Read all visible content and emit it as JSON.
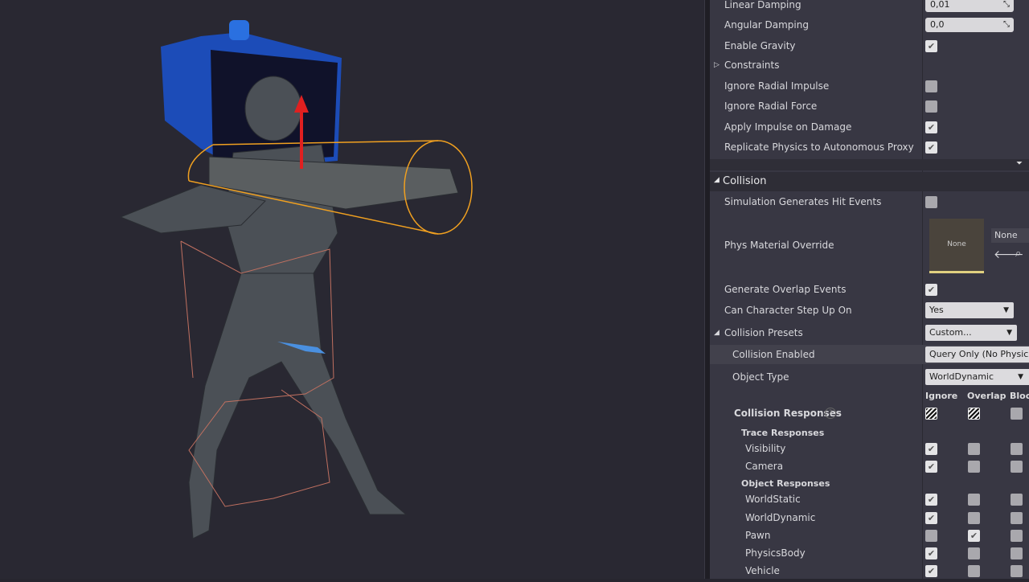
{
  "physics": {
    "linear_damping": {
      "label": "Linear Damping",
      "value": "0,01"
    },
    "angular_damping": {
      "label": "Angular Damping",
      "value": "0,0"
    },
    "enable_gravity": {
      "label": "Enable Gravity",
      "checked": true
    },
    "constraints": {
      "label": "Constraints"
    },
    "ignore_radial_impulse": {
      "label": "Ignore Radial Impulse",
      "checked": false
    },
    "ignore_radial_force": {
      "label": "Ignore Radial Force",
      "checked": false
    },
    "apply_impulse": {
      "label": "Apply Impulse on Damage",
      "checked": true
    },
    "replicate": {
      "label": "Replicate Physics to Autonomous Proxy",
      "checked": true
    }
  },
  "collision": {
    "title": "Collision",
    "sim_hit_events": {
      "label": "Simulation Generates Hit Events",
      "checked": false
    },
    "phys_material": {
      "label": "Phys Material Override",
      "thumb": "None",
      "value": "None"
    },
    "overlap_events": {
      "label": "Generate Overlap Events",
      "checked": true
    },
    "step_up": {
      "label": "Can Character Step Up On",
      "value": "Yes"
    },
    "presets": {
      "label": "Collision Presets",
      "value": "Custom..."
    },
    "enabled": {
      "label": "Collision Enabled",
      "value": "Query Only (No Physics Collision)"
    },
    "object_type": {
      "label": "Object Type",
      "value": "WorldDynamic"
    },
    "columns": [
      "Ignore",
      "Overlap",
      "Block"
    ],
    "responses_label": "Collision Responses",
    "trace_label": "Trace Responses",
    "object_label": "Object Responses",
    "trace": [
      {
        "name": "Visibility",
        "state": "ignore"
      },
      {
        "name": "Camera",
        "state": "ignore"
      }
    ],
    "objects": [
      {
        "name": "WorldStatic",
        "state": "ignore"
      },
      {
        "name": "WorldDynamic",
        "state": "ignore"
      },
      {
        "name": "Pawn",
        "state": "overlap"
      },
      {
        "name": "PhysicsBody",
        "state": "ignore"
      },
      {
        "name": "Vehicle",
        "state": "ignore"
      }
    ]
  },
  "colors": {
    "panel": "#383743",
    "viewport": "#292832",
    "capsule": "#f0a020",
    "arrow_up": "#e02020",
    "box": "#1f5fd0"
  }
}
